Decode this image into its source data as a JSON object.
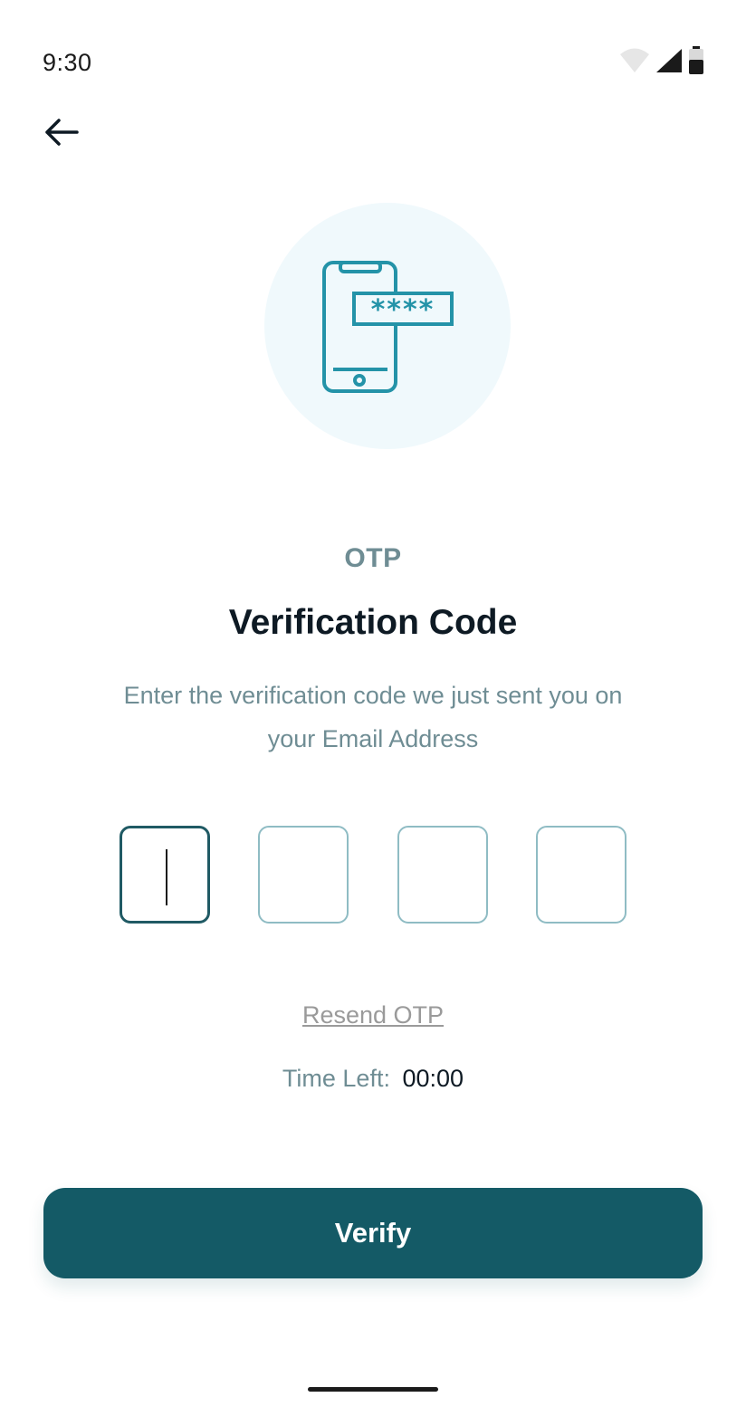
{
  "status_bar": {
    "time": "9:30",
    "icons": [
      "wifi-icon",
      "signal-icon",
      "battery-icon"
    ]
  },
  "header": {
    "back_icon": "arrow-left-icon"
  },
  "hero": {
    "icon": "phone-password-icon",
    "code_mask": "****"
  },
  "content": {
    "eyebrow": "OTP",
    "title": "Verification Code",
    "subtitle_line1": "Enter the verification code we just sent you on",
    "subtitle_line2": "your Email Address"
  },
  "otp": {
    "digits": [
      "",
      "",
      "",
      ""
    ],
    "active_index": 0
  },
  "resend_label": "Resend OTP",
  "timer": {
    "label": "Time Left:",
    "value": "00:00"
  },
  "verify_label": "Verify",
  "colors": {
    "primary": "#145a66",
    "muted": "#6f8d94",
    "hero_bg": "#f0f9fc",
    "icon_accent": "#2493a8",
    "otp_border": "#8fbcc4"
  }
}
